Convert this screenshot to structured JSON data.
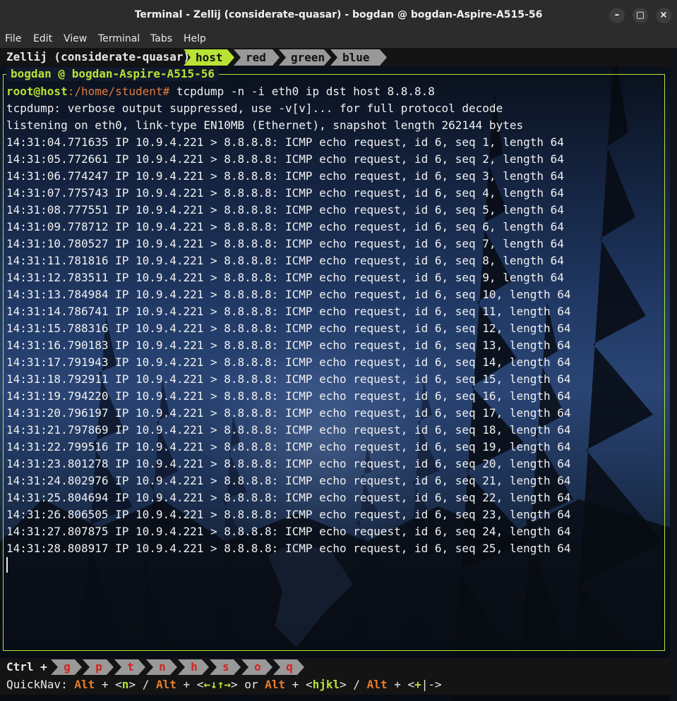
{
  "window": {
    "title": "Terminal - Zellij (considerate-quasar) - bogdan @ bogdan-Aspire-A515-56",
    "minimize": "–",
    "maximize": "▢",
    "close": "×"
  },
  "menu": [
    "File",
    "Edit",
    "View",
    "Terminal",
    "Tabs",
    "Help"
  ],
  "zellij": {
    "session": "Zellij (considerate-quasar)",
    "tabs": [
      {
        "label": "host",
        "active": true
      },
      {
        "label": "red",
        "active": false
      },
      {
        "label": "green",
        "active": false
      },
      {
        "label": "blue",
        "active": false
      }
    ],
    "pane_title": "bogdan @ bogdan-Aspire-A515-56"
  },
  "terminal": {
    "prompt_user": "root@host",
    "prompt_path": ":/home/student#",
    "command": " tcpdump -n -i eth0 ip dst host 8.8.8.8",
    "info": [
      "tcpdump: verbose output suppressed, use -v[v]... for full protocol decode",
      "listening on eth0, link-type EN10MB (Ethernet), snapshot length 262144 bytes"
    ],
    "packets": [
      "14:31:04.771635 IP 10.9.4.221 > 8.8.8.8: ICMP echo request, id 6, seq 1, length 64",
      "14:31:05.772661 IP 10.9.4.221 > 8.8.8.8: ICMP echo request, id 6, seq 2, length 64",
      "14:31:06.774247 IP 10.9.4.221 > 8.8.8.8: ICMP echo request, id 6, seq 3, length 64",
      "14:31:07.775743 IP 10.9.4.221 > 8.8.8.8: ICMP echo request, id 6, seq 4, length 64",
      "14:31:08.777551 IP 10.9.4.221 > 8.8.8.8: ICMP echo request, id 6, seq 5, length 64",
      "14:31:09.778712 IP 10.9.4.221 > 8.8.8.8: ICMP echo request, id 6, seq 6, length 64",
      "14:31:10.780527 IP 10.9.4.221 > 8.8.8.8: ICMP echo request, id 6, seq 7, length 64",
      "14:31:11.781816 IP 10.9.4.221 > 8.8.8.8: ICMP echo request, id 6, seq 8, length 64",
      "14:31:12.783511 IP 10.9.4.221 > 8.8.8.8: ICMP echo request, id 6, seq 9, length 64",
      "14:31:13.784984 IP 10.9.4.221 > 8.8.8.8: ICMP echo request, id 6, seq 10, length 64",
      "14:31:14.786741 IP 10.9.4.221 > 8.8.8.8: ICMP echo request, id 6, seq 11, length 64",
      "14:31:15.788316 IP 10.9.4.221 > 8.8.8.8: ICMP echo request, id 6, seq 12, length 64",
      "14:31:16.790183 IP 10.9.4.221 > 8.8.8.8: ICMP echo request, id 6, seq 13, length 64",
      "14:31:17.791943 IP 10.9.4.221 > 8.8.8.8: ICMP echo request, id 6, seq 14, length 64",
      "14:31:18.792911 IP 10.9.4.221 > 8.8.8.8: ICMP echo request, id 6, seq 15, length 64",
      "14:31:19.794220 IP 10.9.4.221 > 8.8.8.8: ICMP echo request, id 6, seq 16, length 64",
      "14:31:20.796197 IP 10.9.4.221 > 8.8.8.8: ICMP echo request, id 6, seq 17, length 64",
      "14:31:21.797869 IP 10.9.4.221 > 8.8.8.8: ICMP echo request, id 6, seq 18, length 64",
      "14:31:22.799516 IP 10.9.4.221 > 8.8.8.8: ICMP echo request, id 6, seq 19, length 64",
      "14:31:23.801278 IP 10.9.4.221 > 8.8.8.8: ICMP echo request, id 6, seq 20, length 64",
      "14:31:24.802976 IP 10.9.4.221 > 8.8.8.8: ICMP echo request, id 6, seq 21, length 64",
      "14:31:25.804694 IP 10.9.4.221 > 8.8.8.8: ICMP echo request, id 6, seq 22, length 64",
      "14:31:26.806505 IP 10.9.4.221 > 8.8.8.8: ICMP echo request, id 6, seq 23, length 64",
      "14:31:27.807875 IP 10.9.4.221 > 8.8.8.8: ICMP echo request, id 6, seq 24, length 64",
      "14:31:28.808917 IP 10.9.4.221 > 8.8.8.8: ICMP echo request, id 6, seq 25, length 64"
    ]
  },
  "status": {
    "ctrl_label": "Ctrl +",
    "keys": [
      "g",
      "p",
      "t",
      "n",
      "h",
      "s",
      "o",
      "q"
    ],
    "quicknav": {
      "label": "QuickNav:",
      "alt1": "Alt",
      "plus1": " + ",
      "open1": "<",
      "n": "n",
      "close1": ">",
      "sep1": " / ",
      "alt2": "Alt",
      "plus2": " + ",
      "open2": "<",
      "arrows": "←↓↑→",
      "close2": ">",
      "or": " or ",
      "alt3": "Alt",
      "plus3": " + ",
      "open3": "<",
      "hjkl": "hjkl",
      "close3": ">",
      "sep2": " / ",
      "alt4": "Alt",
      "plus4": " + ",
      "open4": "<",
      "plusminus": "+",
      "tail": "|->"
    }
  },
  "colors": {
    "accent": "#b8e334",
    "path": "#e07b3c",
    "key_letter": "#d3211c",
    "alt": "#e87d2a"
  }
}
